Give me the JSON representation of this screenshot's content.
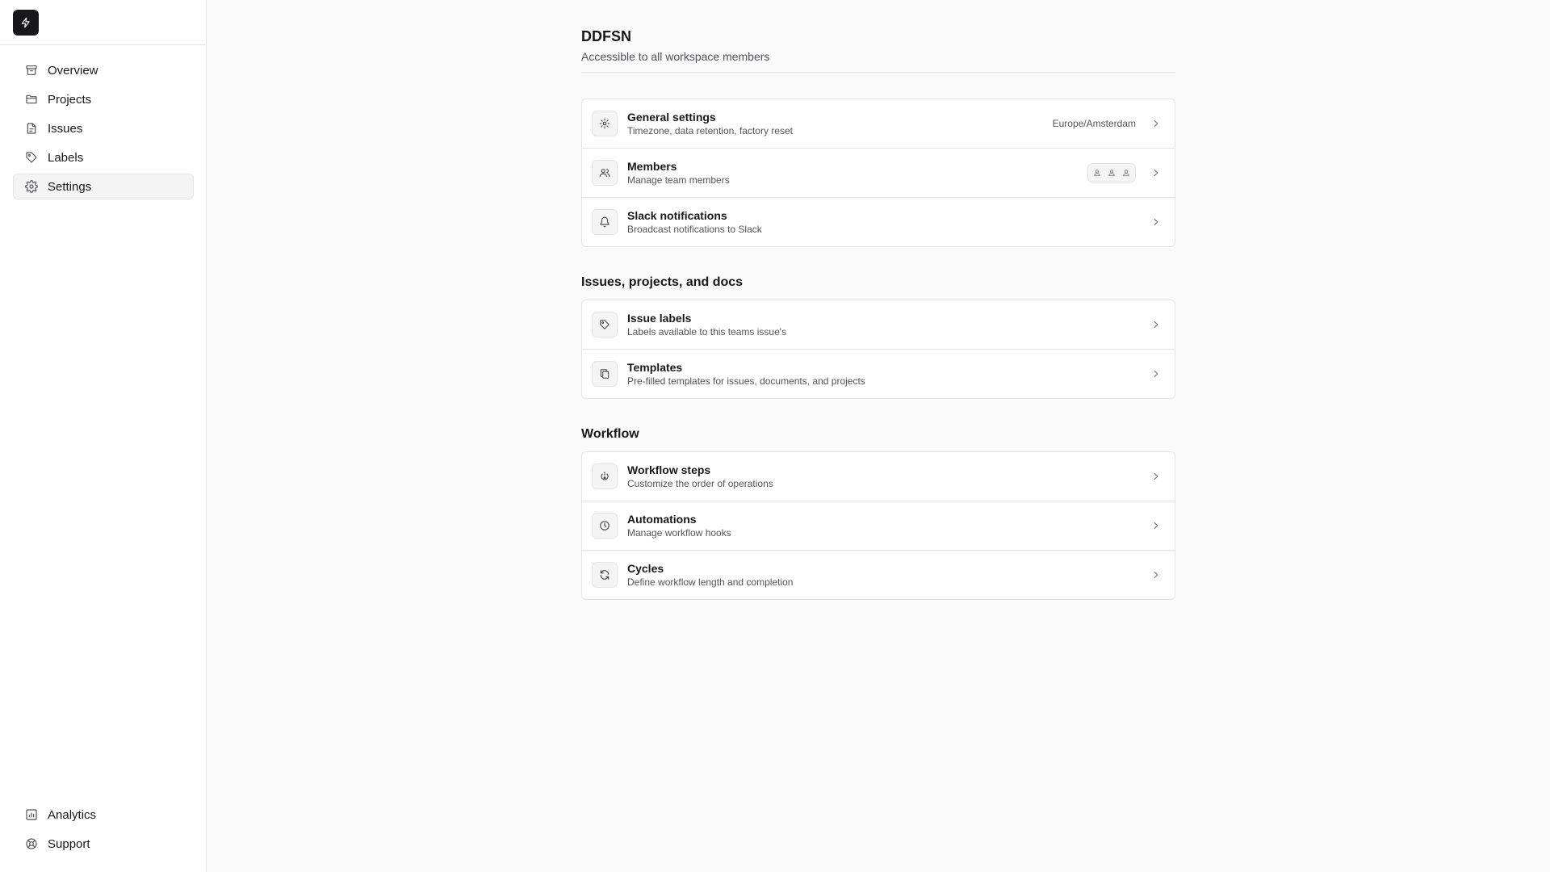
{
  "sidebar": {
    "logo_icon": "bolt-icon",
    "items": [
      {
        "label": "Overview",
        "icon": "archive-icon"
      },
      {
        "label": "Projects",
        "icon": "folder-icon"
      },
      {
        "label": "Issues",
        "icon": "file-icon"
      },
      {
        "label": "Labels",
        "icon": "tag-icon"
      },
      {
        "label": "Settings",
        "icon": "gear-icon",
        "active": true
      }
    ],
    "bottom_items": [
      {
        "label": "Analytics",
        "icon": "chart-icon"
      },
      {
        "label": "Support",
        "icon": "lifebuoy-icon"
      }
    ]
  },
  "header": {
    "title": "DDFSN",
    "subtitle": "Accessible to all workspace members"
  },
  "general": {
    "rows": [
      {
        "title": "General settings",
        "desc": "Timezone, data retention, factory reset",
        "value": "Europe/Amsterdam",
        "icon": "gear-icon"
      },
      {
        "title": "Members",
        "desc": "Manage team members",
        "icon": "users-icon"
      },
      {
        "title": "Slack notifications",
        "desc": "Broadcast notifications to Slack",
        "icon": "bell-icon"
      }
    ]
  },
  "issues_section": {
    "title": "Issues, projects, and docs",
    "rows": [
      {
        "title": "Issue labels",
        "desc": "Labels available to this teams issue's",
        "icon": "tag-icon"
      },
      {
        "title": "Templates",
        "desc": "Pre-filled templates for issues, documents, and projects",
        "icon": "copy-icon"
      }
    ]
  },
  "workflow_section": {
    "title": "Workflow",
    "rows": [
      {
        "title": "Workflow steps",
        "desc": "Customize the order of operations",
        "icon": "steps-icon"
      },
      {
        "title": "Automations",
        "desc": "Manage workflow hooks",
        "icon": "clock-icon"
      },
      {
        "title": "Cycles",
        "desc": "Define workflow length and completion",
        "icon": "refresh-icon"
      }
    ]
  },
  "colors": {
    "background": "#fafafa",
    "sidebar": "#ffffff",
    "border": "#e4e4e7",
    "text": "#18181b",
    "muted": "#52525b"
  }
}
